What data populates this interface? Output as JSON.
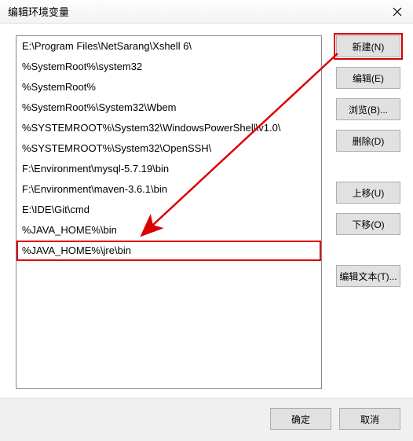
{
  "window": {
    "title": "编辑环境变量"
  },
  "list": {
    "items": [
      "E:\\Program Files\\NetSarang\\Xshell 6\\",
      "%SystemRoot%\\system32",
      "%SystemRoot%",
      "%SystemRoot%\\System32\\Wbem",
      "%SYSTEMROOT%\\System32\\WindowsPowerShell\\v1.0\\",
      "%SYSTEMROOT%\\System32\\OpenSSH\\",
      "F:\\Environment\\mysql-5.7.19\\bin",
      "F:\\Environment\\maven-3.6.1\\bin",
      "E:\\IDE\\Git\\cmd",
      "%JAVA_HOME%\\bin",
      "%JAVA_HOME%\\jre\\bin"
    ],
    "highlighted_index": 10
  },
  "buttons": {
    "new": "新建(N)",
    "edit": "编辑(E)",
    "browse": "浏览(B)...",
    "delete": "删除(D)",
    "moveup": "上移(U)",
    "movedown": "下移(O)",
    "edittext": "编辑文本(T)...",
    "ok": "确定",
    "cancel": "取消"
  },
  "annotations": {
    "highlight_button": "new",
    "arrow_color": "#d00"
  }
}
